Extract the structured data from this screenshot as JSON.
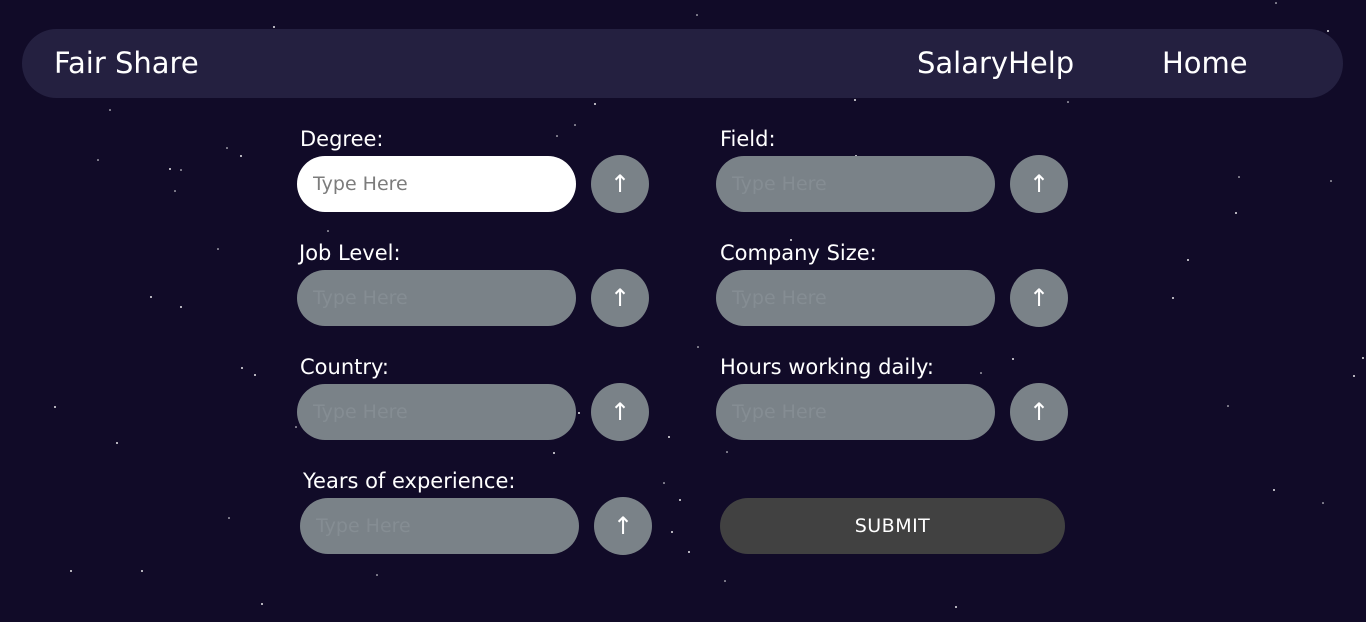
{
  "nav": {
    "brand": "Fair Share",
    "links": [
      "SalaryHelp",
      "Home"
    ]
  },
  "form": {
    "fields": [
      {
        "label": "Degree:",
        "placeholder": "Type Here",
        "value": "",
        "focused": true
      },
      {
        "label": "Field:",
        "placeholder": "Type Here",
        "value": "",
        "focused": false
      },
      {
        "label": "Job Level:",
        "placeholder": "Type Here",
        "value": "",
        "focused": false
      },
      {
        "label": "Company Size:",
        "placeholder": "Type Here",
        "value": "",
        "focused": false
      },
      {
        "label": "Country:",
        "placeholder": "Type Here",
        "value": "",
        "focused": false
      },
      {
        "label": "Hours working daily:",
        "placeholder": "Type Here",
        "value": "",
        "focused": false
      },
      {
        "label": "Years of experience:",
        "placeholder": "Type Here",
        "value": "",
        "focused": false
      }
    ],
    "field_button_icon": "arrow-up-icon",
    "field_button_glyph": "↑",
    "submit_label": "SUBMIT"
  },
  "colors": {
    "background": "#110b28",
    "navbar": "#242040",
    "input_inactive": "#7a8288",
    "input_active": "#ffffff",
    "submit": "#414141",
    "text": "#ffffff"
  }
}
